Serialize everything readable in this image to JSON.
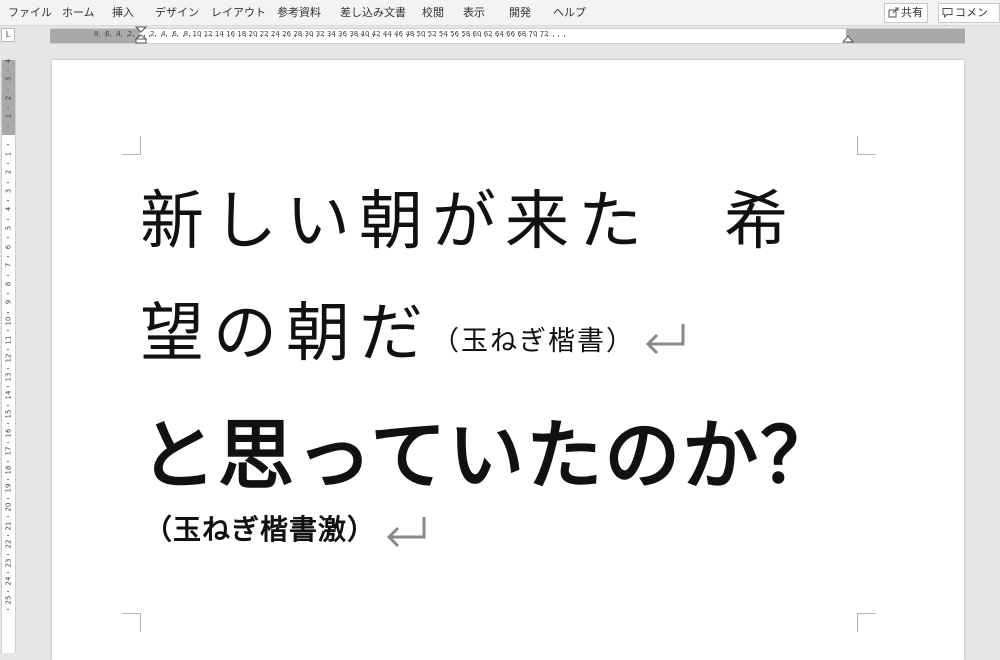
{
  "ribbon": {
    "tabs": [
      "ファイル",
      "ホーム",
      "挿入",
      "デザイン",
      "レイアウト",
      "参考資料",
      "差し込み文書",
      "校閲",
      "表示",
      "開発",
      "ヘルプ"
    ],
    "share_label": "共有",
    "comment_label": "コメント"
  },
  "ruler": {
    "corner_label": "L",
    "horizontal_left_labels": [
      "8",
      "6",
      "4",
      "2"
    ],
    "horizontal_labels": [
      "2",
      "4",
      "6",
      "8",
      "10",
      "12",
      "14",
      "16",
      "18",
      "20",
      "22",
      "24",
      "26",
      "28",
      "30",
      "32",
      "34",
      "36",
      "38",
      "40",
      "42",
      "44",
      "46",
      "48",
      "50",
      "52",
      "54",
      "56",
      "58",
      "60",
      "62",
      "64",
      "66",
      "68",
      "70",
      "72"
    ],
    "vertical_labels": [
      "4",
      "3",
      "2",
      "1",
      "1",
      "2",
      "3",
      "4",
      "5",
      "6",
      "7",
      "8",
      "9",
      "10",
      "11",
      "12",
      "13",
      "14",
      "15",
      "16",
      "17",
      "18",
      "19",
      "20",
      "21",
      "22",
      "23",
      "24",
      "25"
    ]
  },
  "document": {
    "line1": "新しい朝が来た　希",
    "line2": "望の朝だ",
    "line2_font_note": "（玉ねぎ楷書）",
    "line3": "と思っていたのか？",
    "line4": "（玉ねぎ楷書激）",
    "paragraph_mark_color": "#8a8a8a"
  }
}
